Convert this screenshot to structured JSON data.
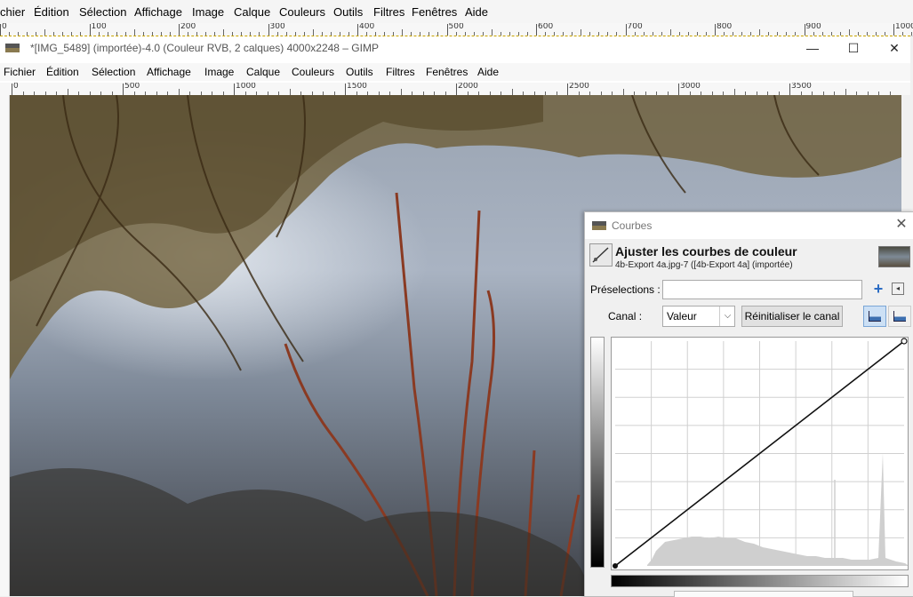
{
  "back_window": {
    "menu": [
      "chier",
      "Édition",
      "Sélection",
      "Affichage",
      "Image",
      "Calque",
      "Couleurs",
      "Outils",
      "Filtres",
      "Fenêtres",
      "Aide"
    ],
    "ruler_labels": [
      "0",
      "100",
      "200",
      "300",
      "400",
      "500",
      "600",
      "700",
      "800",
      "900",
      "1000"
    ]
  },
  "front_window": {
    "title": "*[IMG_5489] (importée)-4.0 (Couleur RVB, 2 calques) 4000x2248 – GIMP",
    "controls": {
      "minimize": "—",
      "maximize": "☐",
      "close": "✕"
    },
    "menu": [
      "Fichier",
      "Édition",
      "Sélection",
      "Affichage",
      "Image",
      "Calque",
      "Couleurs",
      "Outils",
      "Filtres",
      "Fenêtres",
      "Aide"
    ],
    "ruler_labels": [
      "0",
      "500",
      "1000",
      "1500",
      "2000",
      "2500",
      "3000",
      "3500"
    ]
  },
  "curves_dialog": {
    "title": "Courbes",
    "close": "✕",
    "heading": "Ajuster les courbes de couleur",
    "subheading": "4b-Export 4a.jpg-7 ([4b-Export 4a] (importée)",
    "presets_label": "Préselections :",
    "presets_value": "",
    "presets_add": "+",
    "channel_label": "Canal :",
    "channel_value": "Valeur",
    "reset_button": "Réinitialiser le canal",
    "combo_arrow": "⌵",
    "menu_arrow": "◂",
    "curve": {
      "points": [
        [
          0,
          0
        ],
        [
          255,
          255
        ]
      ]
    }
  },
  "colors": {
    "accent": "#2b6cc4",
    "selection_border": "#c8a400",
    "histogram": "#cfcfcf"
  }
}
